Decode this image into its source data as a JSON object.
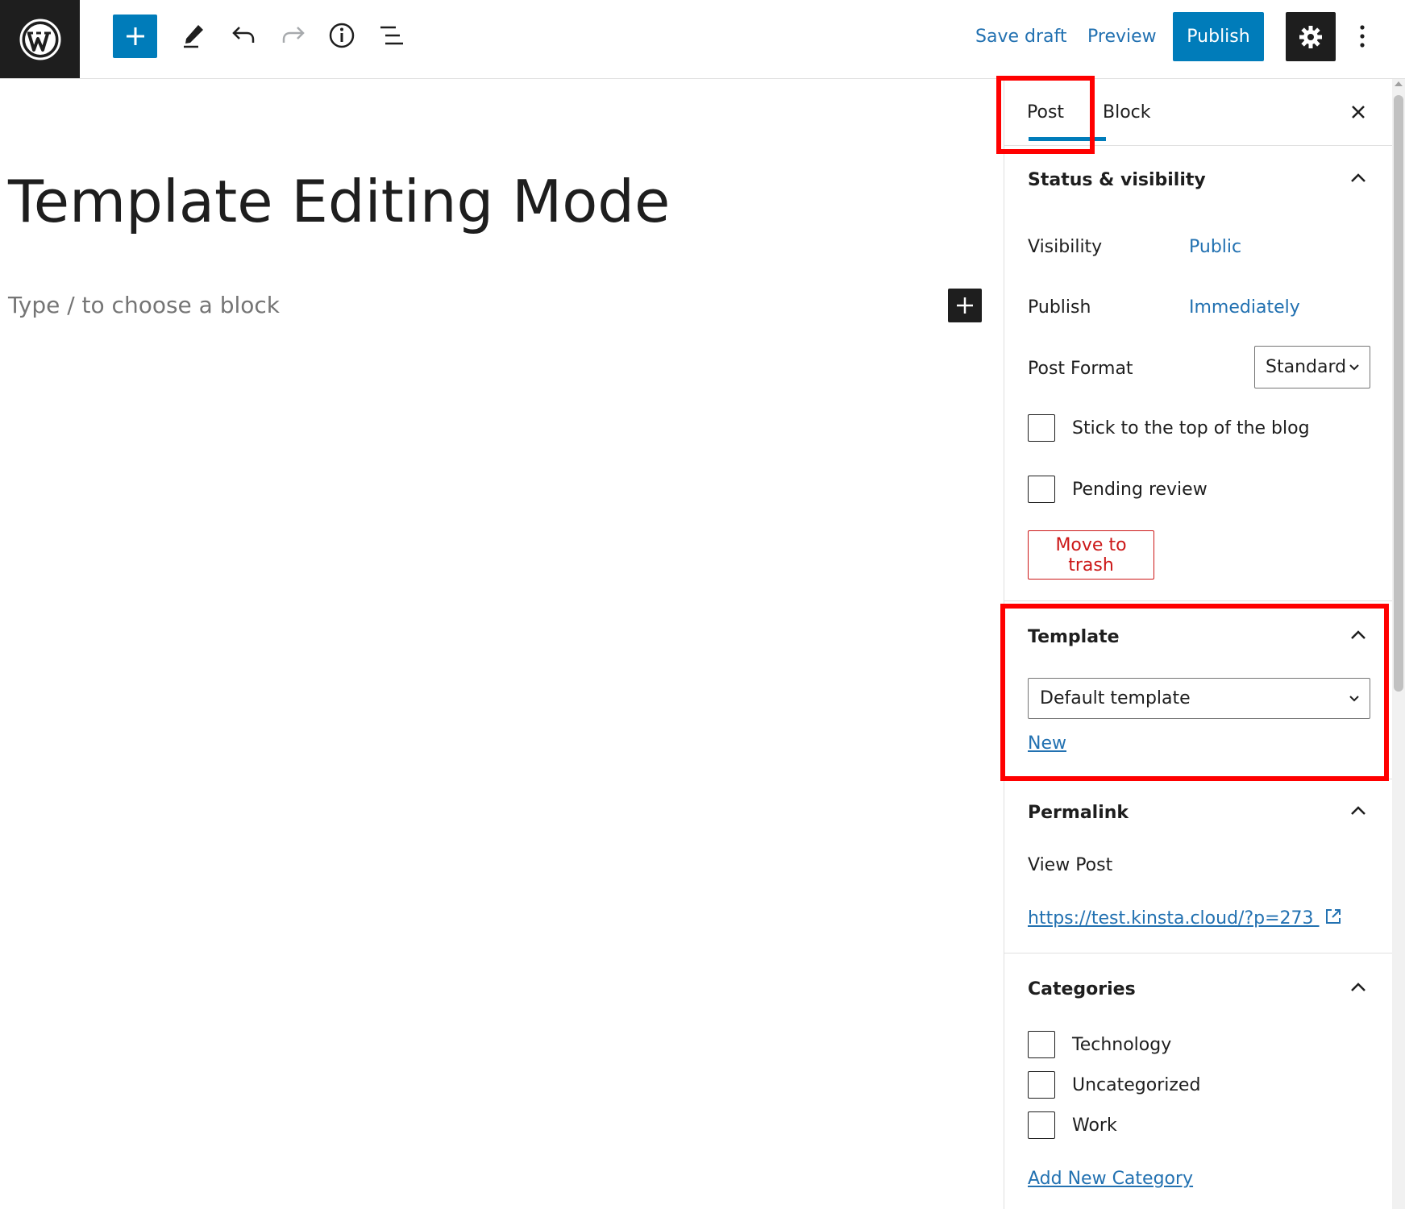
{
  "toolbar": {
    "save_draft_label": "Save draft",
    "preview_label": "Preview",
    "publish_label": "Publish"
  },
  "editor": {
    "title": "Template Editing Mode",
    "block_placeholder": "Type / to choose a block"
  },
  "sidebar": {
    "tabs": [
      {
        "label": "Post",
        "active": true
      },
      {
        "label": "Block",
        "active": false
      }
    ],
    "status_visibility": {
      "title": "Status & visibility",
      "visibility_label": "Visibility",
      "visibility_value": "Public",
      "publish_label": "Publish",
      "publish_value": "Immediately",
      "post_format_label": "Post Format",
      "post_format_value": "Standard",
      "sticky_label": "Stick to the top of the blog",
      "pending_label": "Pending review",
      "trash_label": "Move to trash"
    },
    "template": {
      "title": "Template",
      "selected": "Default template",
      "new_label": "New"
    },
    "permalink": {
      "title": "Permalink",
      "view_post_label": "View Post",
      "url": "https://test.kinsta.cloud/?p=273"
    },
    "categories": {
      "title": "Categories",
      "items": [
        "Technology",
        "Uncategorized",
        "Work"
      ],
      "add_new_label": "Add New Category"
    }
  },
  "colors": {
    "accent": "#007cba",
    "link": "#2271b1",
    "danger": "#cc1818",
    "highlight": "#ff0000",
    "dark": "#1e1e1e"
  }
}
